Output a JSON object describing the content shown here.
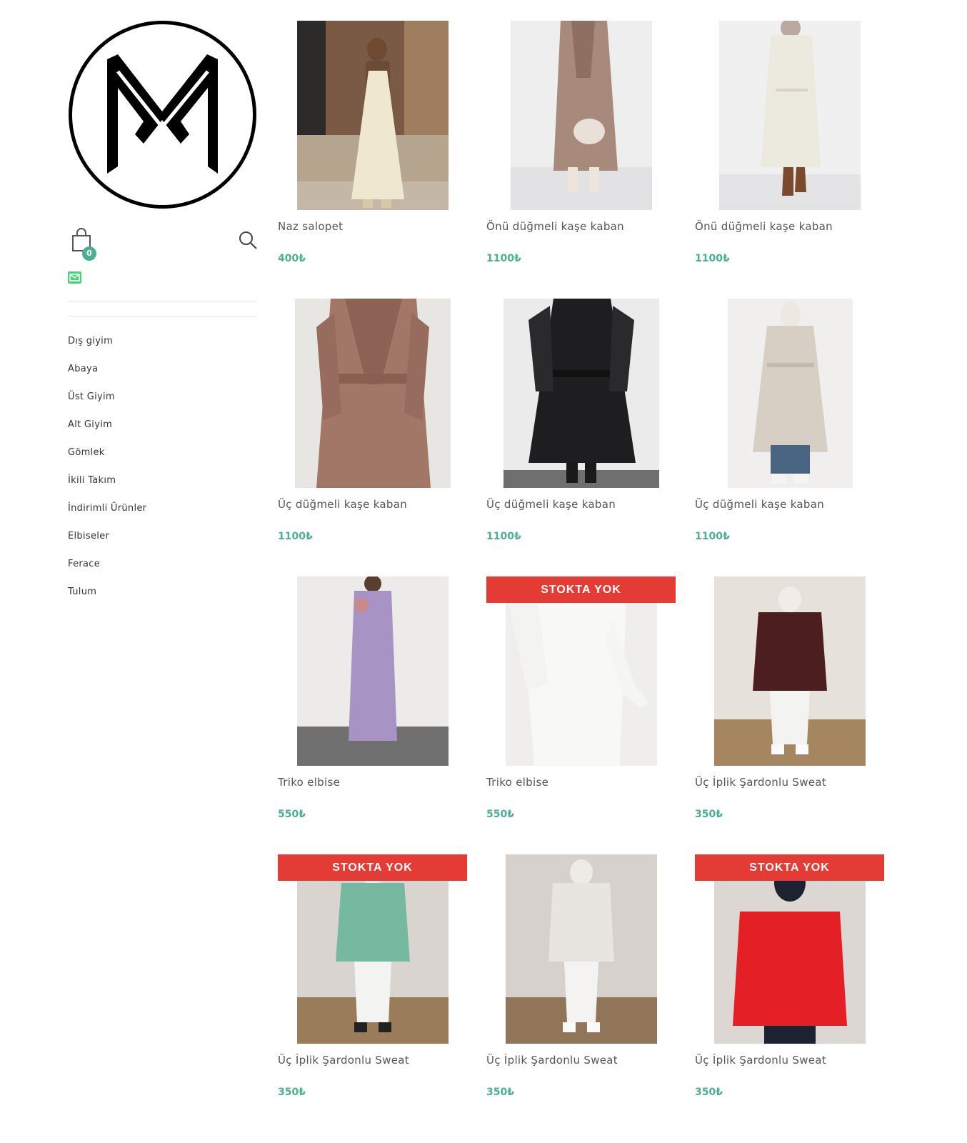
{
  "header": {
    "cart_count": "0"
  },
  "menu": [
    "Dış giyim",
    "Abaya",
    "Üst Giyim",
    "Alt Giyim",
    "Gömlek",
    "İkili Takım",
    "İndirimli Ürünler",
    "Elbiseler",
    "Ferace",
    "Tulum"
  ],
  "products": [
    {
      "title": "Naz salopet",
      "price": "400₺",
      "badge": ""
    },
    {
      "title": "Önü düğmeli kaşe kaban",
      "price": "1100₺",
      "badge": ""
    },
    {
      "title": "Önü düğmeli kaşe kaban",
      "price": "1100₺",
      "badge": ""
    },
    {
      "title": "Üç düğmeli kaşe kaban",
      "price": "1100₺",
      "badge": ""
    },
    {
      "title": "Üç düğmeli kaşe kaban",
      "price": "1100₺",
      "badge": ""
    },
    {
      "title": "Üç düğmeli kaşe kaban",
      "price": "1100₺",
      "badge": ""
    },
    {
      "title": "Triko elbise",
      "price": "550₺",
      "badge": ""
    },
    {
      "title": "Triko elbise",
      "price": "550₺",
      "badge": "STOKTA YOK"
    },
    {
      "title": "Üç İplik Şardonlu Sweat",
      "price": "350₺",
      "badge": ""
    },
    {
      "title": "Üç İplik Şardonlu Sweat",
      "price": "350₺",
      "badge": "STOKTA YOK"
    },
    {
      "title": "Üç İplik Şardonlu Sweat",
      "price": "350₺",
      "badge": ""
    },
    {
      "title": "Üç İplik Şardonlu Sweat",
      "price": "350₺",
      "badge": "STOKTA YOK"
    }
  ],
  "colors": {
    "accent": "#4cae93",
    "out_of_stock": "#e53b35"
  }
}
